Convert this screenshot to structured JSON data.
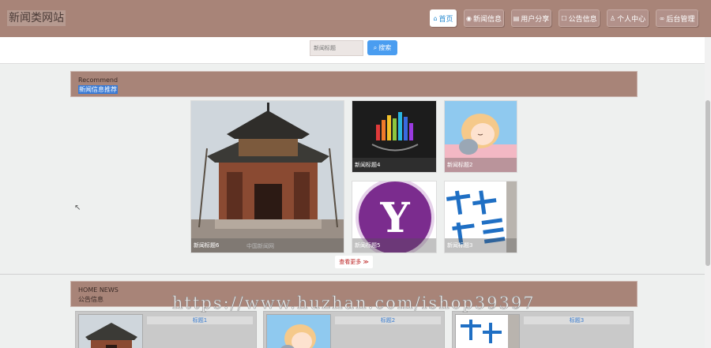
{
  "header": {
    "site_title": "新闻类网站",
    "nav": [
      {
        "label": "首页",
        "icon": "home-icon",
        "glyph": "⌂"
      },
      {
        "label": "新闻信息",
        "icon": "news-icon",
        "glyph": "◉"
      },
      {
        "label": "用户分享",
        "icon": "share-icon",
        "glyph": "▤"
      },
      {
        "label": "公告信息",
        "icon": "notice-icon",
        "glyph": "☐"
      },
      {
        "label": "个人中心",
        "icon": "user-icon",
        "glyph": "♙"
      },
      {
        "label": "后台管理",
        "icon": "link-icon",
        "glyph": "∞"
      }
    ]
  },
  "search": {
    "placeholder": "新闻标题",
    "button_label": "搜索"
  },
  "recommend": {
    "en": "Recommend",
    "cn": "新闻信息推荐",
    "items": [
      {
        "caption": "新闻标题6"
      },
      {
        "caption": "新闻标题4"
      },
      {
        "caption": "新闻标题2"
      },
      {
        "caption": "新闻标题5"
      },
      {
        "caption": "新闻标题3"
      }
    ],
    "photo_watermark": "中国新闻网",
    "more_label": "查看更多 ≫"
  },
  "home_news": {
    "en": "HOME NEWS",
    "cn": "公告信息",
    "cards": [
      {
        "title": "标题1"
      },
      {
        "title": "标题2"
      },
      {
        "title": "标题3"
      }
    ]
  },
  "watermark": "https://www.huzhan.com/ishop39397",
  "colors": {
    "header_bg": "#a88478",
    "accent": "#4a9df0",
    "page_bg": "#eef0ef"
  }
}
